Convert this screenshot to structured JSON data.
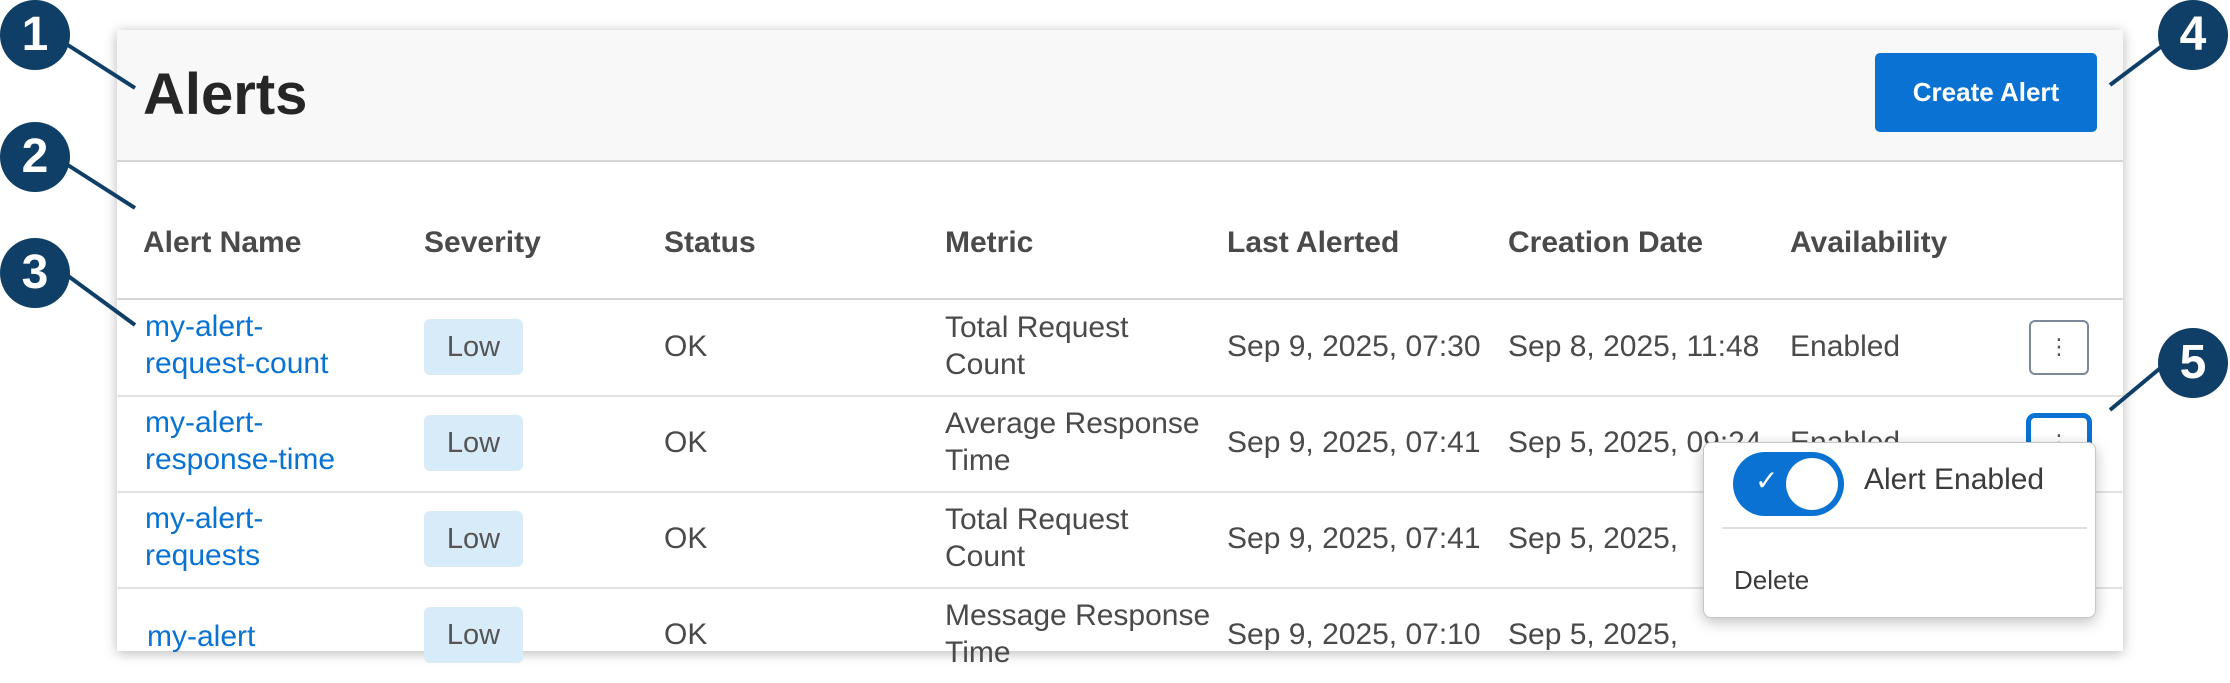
{
  "page": {
    "title": "Alerts",
    "create_button": "Create Alert"
  },
  "columns": [
    "Alert Name",
    "Severity",
    "Status",
    "Metric",
    "Last Alerted",
    "Creation Date",
    "Availability"
  ],
  "rows": [
    {
      "name_line1": "my-alert-",
      "name_line2": "request-count",
      "severity": "Low",
      "status": "OK",
      "metric_line1": "Total Request",
      "metric_line2": "Count",
      "last_alerted": "Sep 9, 2025, 07:30",
      "creation_date": "Sep 8, 2025, 11:48",
      "availability": "Enabled"
    },
    {
      "name_line1": "my-alert-",
      "name_line2": "response-time",
      "severity": "Low",
      "status": "OK",
      "metric_line1": "Average Response",
      "metric_line2": "Time",
      "last_alerted": "Sep 9, 2025, 07:41",
      "creation_date": "Sep 5, 2025, 09:24",
      "availability": "Enabled"
    },
    {
      "name_line1": "my-alert-",
      "name_line2": "requests",
      "severity": "Low",
      "status": "OK",
      "metric_line1": "Total Request",
      "metric_line2": "Count",
      "last_alerted": "Sep 9, 2025, 07:41",
      "creation_date": "Sep 5, 2025,",
      "availability": ""
    },
    {
      "name_line1": "my-alert",
      "name_line2": "",
      "severity": "Low",
      "status": "OK",
      "metric_line1": "Message Response",
      "metric_line2": "Time",
      "last_alerted": "Sep 9, 2025, 07:10",
      "creation_date": "Sep 5, 2025,",
      "availability": ""
    }
  ],
  "menu": {
    "toggle_label": "Alert Enabled",
    "toggle_on": true,
    "delete_label": "Delete"
  },
  "callouts": [
    "1",
    "2",
    "3",
    "4",
    "5"
  ],
  "colors": {
    "accent": "#0972d3",
    "callout": "#0f3f66",
    "badge": "#d7ebf9"
  },
  "icons": {
    "kebab": "vertical-ellipsis-icon",
    "check": "check-icon"
  }
}
